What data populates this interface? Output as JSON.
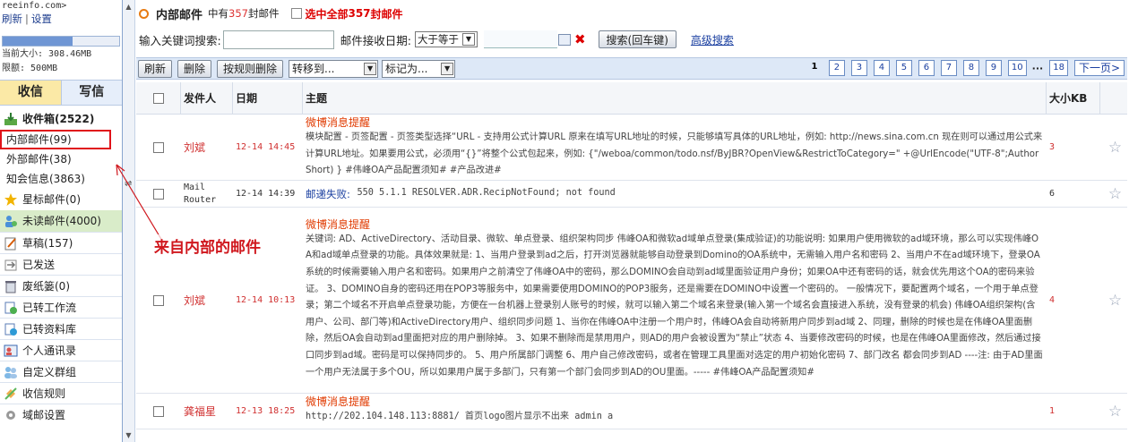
{
  "sidebar": {
    "account": "reeinfo.com>",
    "links": {
      "refresh": "刷新",
      "settings": "设置"
    },
    "quota": {
      "fill": 0.6,
      "capacity_label": "当前大小: 308.46MB",
      "limit_label": "限额: 500MB"
    },
    "tabs": {
      "receive": "收信",
      "write": "写信"
    },
    "folders": [
      {
        "label": "收件箱(2522)",
        "icon": "inbox-icon"
      },
      {
        "label": "内部邮件(99)"
      },
      {
        "label": "外部邮件(38)"
      },
      {
        "label": "知会信息(3863)"
      },
      {
        "label": "星标邮件(0)",
        "icon": "star-icon"
      },
      {
        "label": "未读邮件(4000)",
        "icon": "unread-icon"
      },
      {
        "label": "草稿(157)",
        "icon": "draft-icon"
      },
      {
        "label": "已发送",
        "icon": "sent-icon"
      },
      {
        "label": "废纸篓(0)",
        "icon": "trash-icon"
      },
      {
        "label": "已转工作流",
        "icon": "workflow-icon"
      },
      {
        "label": "已转资料库",
        "icon": "library-icon"
      },
      {
        "label": "个人通讯录",
        "icon": "contacts-icon"
      },
      {
        "label": "自定义群组",
        "icon": "group-icon"
      },
      {
        "label": "收信规则",
        "icon": "rule-icon"
      },
      {
        "label": "域邮设置",
        "icon": "settings-icon"
      }
    ]
  },
  "main": {
    "title": "内部邮件",
    "count_prefix": "中有",
    "count_num": "357",
    "count_suffix": "封邮件",
    "select_all_prefix": "选中全部",
    "select_all_num": "357",
    "select_all_suffix": "封邮件",
    "search": {
      "keyword_label": "输入关键词搜索:",
      "date_label": "邮件接收日期:",
      "date_op": "大于等于",
      "search_button": "搜索(回车键)",
      "advanced": "高级搜索"
    },
    "toolbar": {
      "refresh": "刷新",
      "delete": "删除",
      "rule_delete": "按规则删除",
      "move_to": "转移到...",
      "mark_as": "标记为..."
    },
    "pager": {
      "pages": [
        "1",
        "2",
        "3",
        "4",
        "5",
        "6",
        "7",
        "8",
        "9",
        "10"
      ],
      "last": "18",
      "next": "下一页>",
      "current": "1"
    },
    "table": {
      "headers": {
        "from": "发件人",
        "date": "日期",
        "subject": "主题",
        "size": "大小KB"
      },
      "rows": [
        {
          "from": "刘斌",
          "date": "12-14 14:45",
          "title": "微博消息提醒",
          "body": "模块配置 - 页签配置 - 页签类型选择“URL - 支持用公式计算URL 原来在填写URL地址的时候，只能够填写具体的URL地址，例如: http://news.sina.com.cn 现在则可以通过用公式来计算URL地址。如果要用公式，必须用“{}”将整个公式包起来，例如: {\"/weboa/common/todo.nsf/ByJBR?OpenView&RestrictToCategory=\" +@UrlEncode(\"UTF-8\";AuthorShort) } #伟峰OA产品配置须知# #产品改进#",
          "size": "3"
        },
        {
          "from": "Mail Router",
          "date": "12-14 14:39",
          "title": "邮递失败:",
          "body": "550 5.1.1 RESOLVER.ADR.RecipNotFound; not found",
          "size": "6"
        },
        {
          "from": "刘斌",
          "date": "12-14 10:13",
          "title": "微博消息提醒",
          "body": "关键词: AD、ActiveDirectory、活动目录、微软、单点登录、组织架构同步 伟峰OA和微软ad域单点登录(集成验证)的功能说明: 如果用户使用微软的ad域环境，那么可以实现伟峰OA和ad域单点登录的功能。具体效果就是: 1、当用户登录到ad之后，打开浏览器就能够自动登录到Domino的OA系统中，无需输入用户名和密码 2、当用户不在ad域环境下，登录OA系统的时候需要输入用户名和密码。如果用户之前清空了伟峰OA中的密码，那么DOMINO会自动到ad域里面验证用户身份；如果OA中还有密码的话，就会优先用这个OA的密码来验证。 3、DOMINO自身的密码还用在POP3等服务中，如果需要使用DOMINO的POP3服务，还是需要在DOMINO中设置一个密码的。 一般情况下，要配置两个域名，一个用于单点登录；第二个域名不开启单点登录功能，方便在一台机器上登录别人账号的时候，就可以输入第二个域名来登录(输入第一个域名会直接进入系统，没有登录的机会) 伟峰OA组织架构(含用户、公司、部门等)和ActiveDirectory用户、组织同步问题 1、当你在伟峰OA中注册一个用户时，伟峰OA会自动将新用户同步到ad域 2、同理，删除的时候也是在伟峰OA里面删除，然后OA会自动到ad里面把对应的用户删除掉。 3、如果不删除而是禁用用户，则AD的用户会被设置为“禁止”状态 4、当要修改密码的时候，也是在伟峰OA里面修改，然后通过接口同步到ad域。密码是可以保持同步的。 5、用户所属部门调整 6、用户自己修改密码，或者在管理工具里面对选定的用户初始化密码 7、部门改名 都会同步到AD ----注: 由于AD里面一个用户无法属于多个OU，所以如果用户属于多部门，只有第一个部门会同步到AD的OU里面。----- #伟峰OA产品配置须知#",
          "size": "4"
        },
        {
          "from": "龚福星",
          "date": "12-13 18:25",
          "title": "微博消息提醒",
          "body": "http://202.104.148.113:8881/ 首页logo图片显示不出来 admin a",
          "size": "1"
        }
      ]
    }
  },
  "annotation": "来自内部的邮件"
}
